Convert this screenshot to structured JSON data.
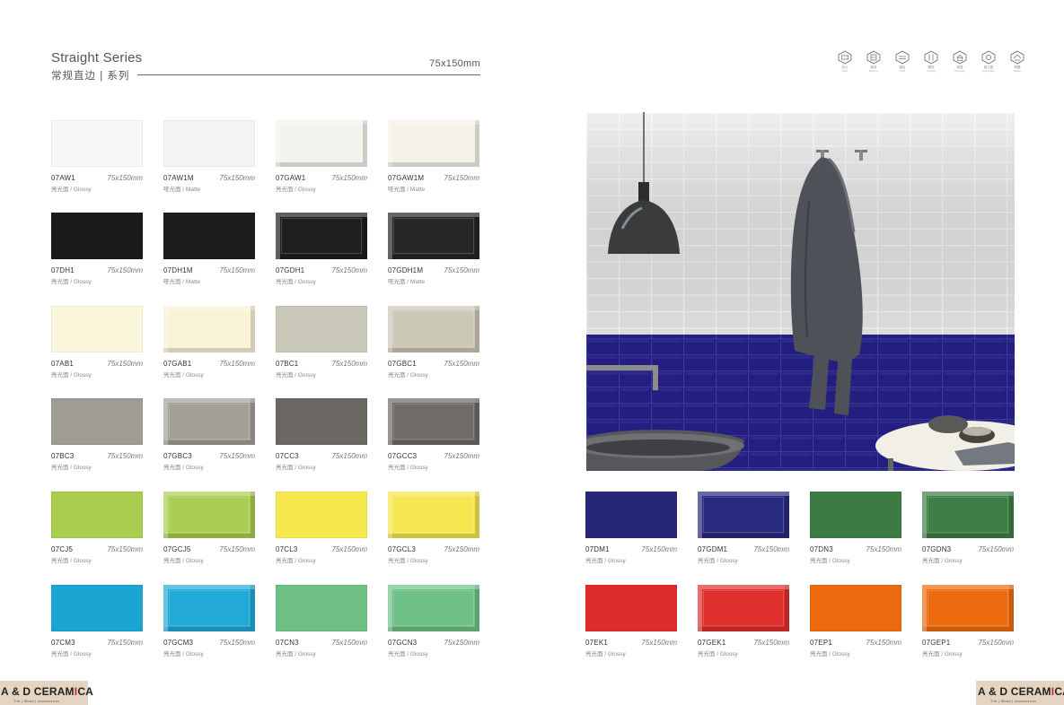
{
  "header": {
    "title_en": "Straight Series",
    "title_cn": "常规直边 | 系列",
    "size": "75x150mm"
  },
  "applications": [
    {
      "icon": "office-icon",
      "cn": "办公",
      "en": "Work"
    },
    {
      "icon": "business-icon",
      "cn": "商务",
      "en": "Business"
    },
    {
      "icon": "hotel-icon",
      "cn": "酒店",
      "en": "Hotel"
    },
    {
      "icon": "catering-icon",
      "cn": "餐饮",
      "en": "Catering"
    },
    {
      "icon": "home-icon",
      "cn": "家居",
      "en": "Homestay"
    },
    {
      "icon": "kindergarten-icon",
      "cn": "幼儿园",
      "en": "Kindergarten"
    },
    {
      "icon": "villa-icon",
      "cn": "别墅",
      "en": "Villadom"
    }
  ],
  "tiles": [
    {
      "code": "07AW1",
      "size": "75x150mm",
      "finish": "亮光面 / Glossy",
      "color": "#f7f7f5",
      "bevel": false
    },
    {
      "code": "07AW1M",
      "size": "75x150mm",
      "finish": "哑光面 / Matte",
      "color": "#f4f4f2",
      "bevel": false
    },
    {
      "code": "07GAW1",
      "size": "75x150mm",
      "finish": "亮光面 / Glossy",
      "color": "#f3f3ee",
      "bevel": true
    },
    {
      "code": "07GAW1M",
      "size": "75x150mm",
      "finish": "哑光面 / Matte",
      "color": "#f5f3e8",
      "bevel": true
    },
    {
      "code": "07DH1",
      "size": "75x150mm",
      "finish": "亮光面 / Glossy",
      "color": "#1b1b1b",
      "bevel": false
    },
    {
      "code": "07DH1M",
      "size": "75x150mm",
      "finish": "哑光面 / Matte",
      "color": "#1d1d1d",
      "bevel": false
    },
    {
      "code": "07GDH1",
      "size": "75x150mm",
      "finish": "亮光面 / Glossy",
      "color": "#1e1e1e",
      "bevel": true
    },
    {
      "code": "07GDH1M",
      "size": "75x150mm",
      "finish": "哑光面 / Matte",
      "color": "#262626",
      "bevel": true
    },
    {
      "code": "07AB1",
      "size": "75x150mm",
      "finish": "亮光面 / Glossy",
      "color": "#fbf7dd",
      "bevel": false
    },
    {
      "code": "07GAB1",
      "size": "75x150mm",
      "finish": "亮光面 / Glossy",
      "color": "#f9f3d6",
      "bevel": true
    },
    {
      "code": "07BC1",
      "size": "75x150mm",
      "finish": "亮光面 / Glossy",
      "color": "#c9c7b7",
      "bevel": false
    },
    {
      "code": "07GBC1",
      "size": "75x150mm",
      "finish": "亮光面 / Glossy",
      "color": "#cbc8b6",
      "bevel": true
    },
    {
      "code": "07BC3",
      "size": "75x150mm",
      "finish": "亮光面 / Glossy",
      "color": "#9e9c95",
      "bevel": false
    },
    {
      "code": "07GBC3",
      "size": "75x150mm",
      "finish": "亮光面 / Glossy",
      "color": "#a19f96",
      "bevel": true
    },
    {
      "code": "07CC3",
      "size": "75x150mm",
      "finish": "亮光面 / Glossy",
      "color": "#6b6864",
      "bevel": false
    },
    {
      "code": "07GCC3",
      "size": "75x150mm",
      "finish": "亮光面 / Glossy",
      "color": "#6e6b68",
      "bevel": true
    },
    {
      "code": "07CJ5",
      "size": "75x150mm",
      "finish": "亮光面 / Glossy",
      "color": "#a8cd4f",
      "bevel": false
    },
    {
      "code": "07GCJ5",
      "size": "75x150mm",
      "finish": "亮光面 / Glossy",
      "color": "#a9ce52",
      "bevel": true
    },
    {
      "code": "07CL3",
      "size": "75x150mm",
      "finish": "亮光面 / Glossy",
      "color": "#f6e84e",
      "bevel": false
    },
    {
      "code": "07GCL3",
      "size": "75x150mm",
      "finish": "亮光面 / Glossy",
      "color": "#f5e650",
      "bevel": true
    },
    {
      "code": "07CM3",
      "size": "75x150mm",
      "finish": "亮光面 / Glossy",
      "color": "#1aa5d2",
      "bevel": false
    },
    {
      "code": "07GCM3",
      "size": "75x150mm",
      "finish": "亮光面 / Glossy",
      "color": "#22a9d7",
      "bevel": true
    },
    {
      "code": "07CN3",
      "size": "75x150mm",
      "finish": "亮光面 / Glossy",
      "color": "#6dbf84",
      "bevel": false
    },
    {
      "code": "07GCN3",
      "size": "75x150mm",
      "finish": "亮光面 / Glossy",
      "color": "#70c187",
      "bevel": true
    },
    {
      "code": "07DM1",
      "size": "75x150mm",
      "finish": "亮光面 / Glossy",
      "color": "#272777",
      "bevel": false
    },
    {
      "code": "07GDM1",
      "size": "75x150mm",
      "finish": "亮光面 / Glossy",
      "color": "#282a7e",
      "bevel": true
    },
    {
      "code": "07DN3",
      "size": "75x150mm",
      "finish": "亮光面 / Glossy",
      "color": "#3c7b43",
      "bevel": false
    },
    {
      "code": "07GDN3",
      "size": "75x150mm",
      "finish": "亮光面 / Glossy",
      "color": "#3e7e46",
      "bevel": true
    },
    {
      "code": "07EK1",
      "size": "75x150mm",
      "finish": "亮光面 / Glossy",
      "color": "#dc2c2b",
      "bevel": false
    },
    {
      "code": "07GEK1",
      "size": "75x150mm",
      "finish": "亮光面 / Glossy",
      "color": "#df2f2d",
      "bevel": true
    },
    {
      "code": "07EP1",
      "size": "75x150mm",
      "finish": "亮光面 / Glossy",
      "color": "#ec6a0e",
      "bevel": false
    },
    {
      "code": "07GEP1",
      "size": "75x150mm",
      "finish": "亮光面 / Glossy",
      "color": "#ee6c10",
      "bevel": true
    }
  ],
  "logos": {
    "left_a": "A & D CERAM",
    "left_b": "I",
    "left_c": "CA",
    "left_tag": "Tile | Wood | Accessories",
    "right_a": "A & D CERAM",
    "right_b": "I",
    "right_c": "CA",
    "right_tag": "Tile | Wood | Accessories"
  },
  "colors": {
    "brand_red": "#c0282d",
    "logo_bg": "#e5d4c2"
  }
}
